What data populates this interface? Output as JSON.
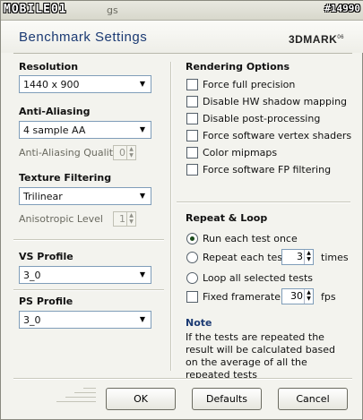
{
  "watermark": {
    "logo": "MOBILE01",
    "title_rest": "gs",
    "id": "#14990"
  },
  "header": {
    "title": "Benchmark Settings",
    "brand": "3DMARK",
    "brand_version": "06"
  },
  "left": {
    "resolution": {
      "label": "Resolution",
      "value": "1440 x 900"
    },
    "anti_aliasing": {
      "label": "Anti-Aliasing",
      "value": "4 sample AA",
      "quality_label": "Anti-Aliasing Quality",
      "quality_value": "0"
    },
    "texture_filtering": {
      "label": "Texture Filtering",
      "value": "Trilinear",
      "aniso_label": "Anisotropic Level",
      "aniso_value": "1"
    },
    "vs_profile": {
      "label": "VS Profile",
      "value": "3_0"
    },
    "ps_profile": {
      "label": "PS Profile",
      "value": "3_0"
    }
  },
  "rendering": {
    "title": "Rendering Options",
    "options": [
      {
        "label": "Force full precision",
        "checked": false
      },
      {
        "label": "Disable HW shadow mapping",
        "checked": false
      },
      {
        "label": "Disable post-processing",
        "checked": false
      },
      {
        "label": "Force software vertex shaders",
        "checked": false
      },
      {
        "label": "Color mipmaps",
        "checked": false
      },
      {
        "label": "Force software FP filtering",
        "checked": false
      }
    ]
  },
  "repeat": {
    "title": "Repeat & Loop",
    "run_once": "Run each test once",
    "repeat_each": "Repeat each test",
    "repeat_count": "3",
    "times": "times",
    "loop_all": "Loop all selected tests",
    "fixed_framerate": "Fixed framerate",
    "fps_value": "30",
    "fps": "fps",
    "selected": "run_once"
  },
  "note": {
    "title": "Note",
    "text": "If the tests are repeated the result will be calculated based on the average of all the repeated tests"
  },
  "buttons": {
    "ok": "OK",
    "defaults": "Defaults",
    "cancel": "Cancel"
  }
}
